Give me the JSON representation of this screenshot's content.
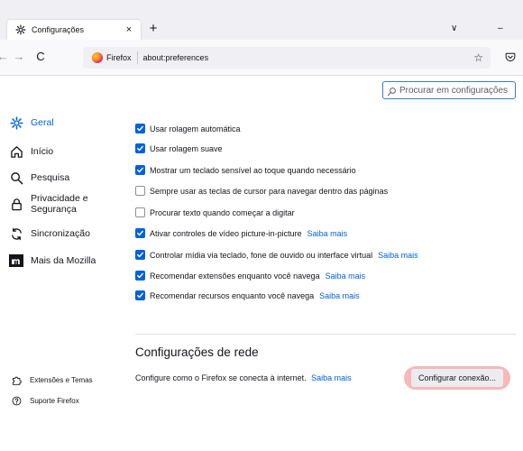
{
  "tab": {
    "title": "Configurações",
    "close": "×",
    "new_tab": "+"
  },
  "window_controls": {
    "list_tabs": "∨",
    "minimize": "–"
  },
  "nav": {
    "back": "←",
    "forward": "→",
    "reload": "C"
  },
  "urlbar": {
    "identity": "Firefox",
    "url": "about:preferences",
    "star": "☆"
  },
  "search": {
    "placeholder": "Procurar em configurações"
  },
  "sidebar": {
    "items": [
      {
        "label": "Geral",
        "icon": "gear-icon",
        "selected": true
      },
      {
        "label": "Início",
        "icon": "home-icon"
      },
      {
        "label": "Pesquisa",
        "icon": "search-icon"
      },
      {
        "label": "Privacidade e Segurança",
        "line1": "Privacidade e",
        "line2": "Segurança",
        "icon": "lock-icon"
      },
      {
        "label": "Sincronização",
        "icon": "sync-icon"
      },
      {
        "label": "Mais da Mozilla",
        "icon": "mozilla-icon"
      }
    ],
    "footer": [
      {
        "label": "Extensões e Temas",
        "icon": "puzzle-icon"
      },
      {
        "label": "Suporte Firefox",
        "icon": "help-icon"
      }
    ]
  },
  "options": [
    {
      "label": "Usar rolagem automática",
      "checked": true
    },
    {
      "label": "Usar rolagem suave",
      "checked": true
    },
    {
      "label": "Mostrar um teclado sensível ao toque quando necessário",
      "checked": true
    },
    {
      "label": "Sempre usar as teclas de cursor para navegar dentro das páginas",
      "checked": false
    },
    {
      "label": "Procurar texto quando começar a digitar",
      "checked": false
    },
    {
      "label": "Ativar controles de vídeo picture-in-picture",
      "checked": true,
      "more": "Saiba mais"
    },
    {
      "label": "Controlar mídia via teclado, fone de ouvido ou interface virtual",
      "checked": true,
      "more": "Saiba mais"
    },
    {
      "label": "Recomendar extensões enquanto você navega",
      "checked": true,
      "more": "Saiba mais"
    },
    {
      "label": "Recomendar recursos enquanto você navega",
      "checked": true,
      "more": "Saiba mais"
    }
  ],
  "network": {
    "heading": "Configurações de rede",
    "description": "Configure como o Firefox se conecta à internet.",
    "more": "Saiba mais",
    "button": "Configurar conexão..."
  },
  "colors": {
    "accent": "#0061e0",
    "highlight": "#f6b8b8"
  }
}
